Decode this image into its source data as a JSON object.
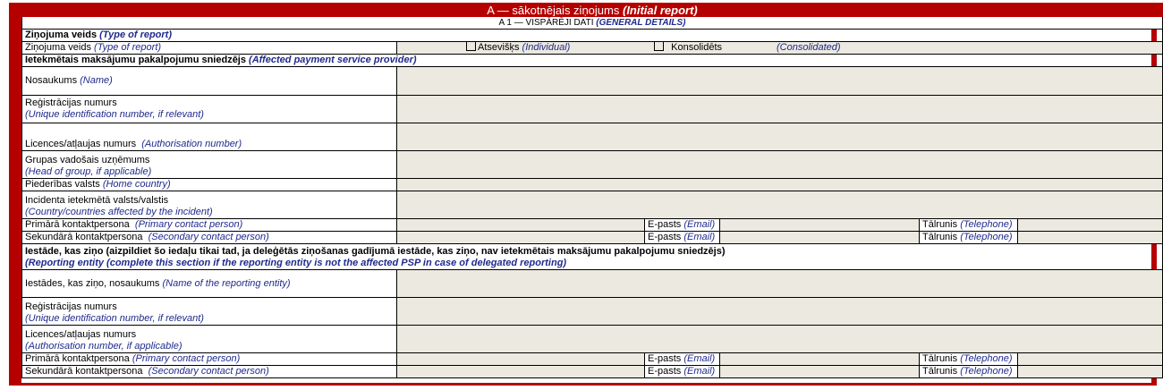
{
  "header": {
    "title_lv": "A — sākotnējais ziņojums",
    "title_en": "(Initial report)",
    "subtitle_lv": "A 1 — VISPĀRĒJI DATI",
    "subtitle_en": "(GENERAL DETAILS)"
  },
  "report_type": {
    "section_lv": "Ziņojuma veids",
    "section_en": "(Type of report)",
    "label_lv": "Ziņojuma veids",
    "label_en": "(Type of report)",
    "option_individual_lv": "Atsevišķs",
    "option_individual_en": "(Individual)",
    "option_consolidated_lv": "Konsolidēts",
    "option_consolidated_en": "(Consolidated)"
  },
  "affected_psp": {
    "section_lv": "Ietekmētais maksājumu pakalpojumu sniedzējs",
    "section_en": "(Affected payment service provider)",
    "name_lv": "Nosaukums",
    "name_en": "(Name)",
    "reg_lv": "Reģistrācijas numurs",
    "reg_en": "(Unique identification number, if relevant)",
    "licence_lv": "Licences/atļaujas numurs",
    "licence_en": "(Authorisation number)",
    "group_lv": "Grupas vadošais uzņēmums",
    "group_en": "(Head of group, if applicable)",
    "home_lv": "Piederības valsts",
    "home_en": "(Home country)",
    "affected_lv": "Incidenta ietekmētā valsts/valstis",
    "affected_en": "(Country/countries affected by the incident)",
    "primary_lv": "Primārā kontaktpersona",
    "primary_en": "(Primary contact person)",
    "secondary_lv": "Sekundārā kontaktpersona",
    "secondary_en": "(Secondary contact person)"
  },
  "contact": {
    "email_lv": "E-pasts",
    "email_en": "(Email)",
    "phone_lv": "Tālrunis",
    "phone_en": "(Telephone)"
  },
  "reporting_entity": {
    "section_lv": "Iestāde, kas ziņo (aizpildiet šo iedaļu tikai tad, ja deleģētās ziņošanas gadījumā iestāde, kas ziņo, nav ietekmētais maksājumu pakalpojumu sniedzējs)",
    "section_en": "(Reporting entity (complete this section if the reporting entity is not the affected PSP in case of delegated reporting)",
    "name_lv": "Iestādes, kas ziņo, nosaukums",
    "name_en": "(Name of the reporting entity)",
    "reg_lv": "Reģistrācijas numurs",
    "reg_en": "(Unique identification number, if relevant)",
    "licence_lv": "Licences/atļaujas numurs",
    "licence_en": "(Authorisation number, if applicable)",
    "primary_lv": "Primārā kontaktpersona",
    "primary_en": "(Primary contact person)",
    "secondary_lv": "Sekundārā kontaktpersona",
    "secondary_en": "(Secondary contact person)"
  }
}
